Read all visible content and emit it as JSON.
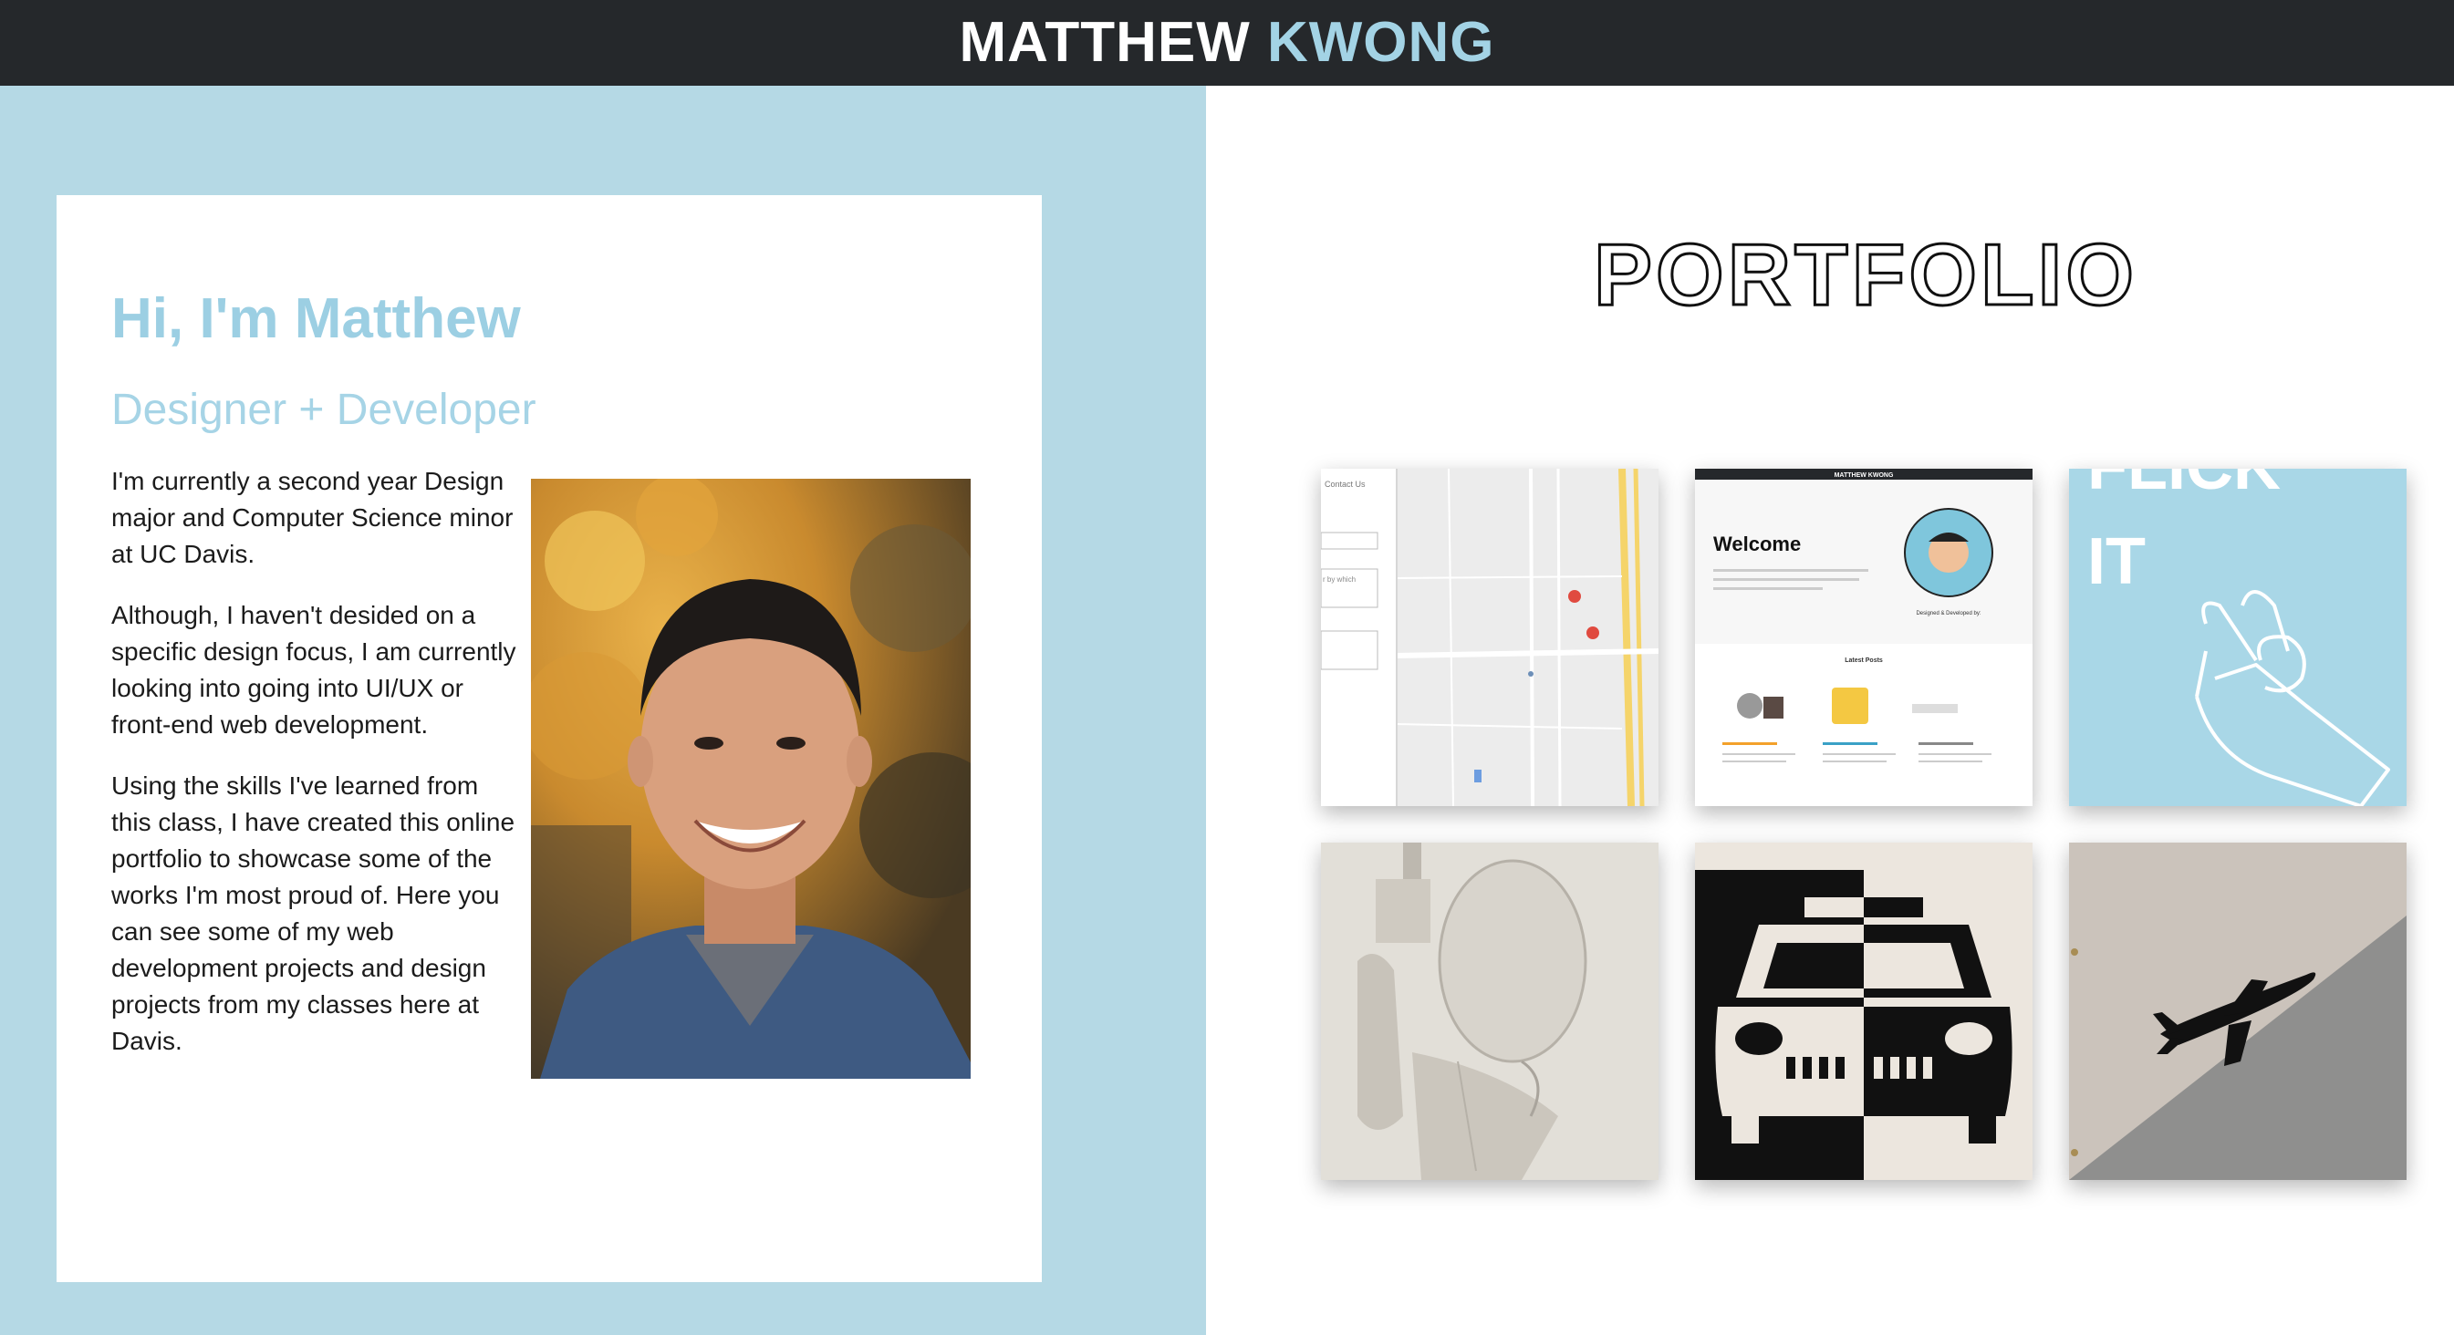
{
  "header": {
    "first_name": "MATTHEW",
    "last_name": "KWONG"
  },
  "intro": {
    "greeting": "Hi, I'm Matthew",
    "role": "Designer + Developer",
    "paragraphs": [
      "I'm currently a second year Design major and Computer Science minor at UC Davis.",
      "Although, I haven't desided on a specific design focus, I am currently looking into going into UI/UX or front-end web development.",
      "Using the skills I've learned from this class, I have created this online portfolio to showcase some of the works I'm most proud of. Here you can see some of my web development projects and design projects from my classes here at Davis."
    ]
  },
  "portfolio": {
    "title": "PORTFOLIO",
    "tiles": [
      {
        "name": "map-contact-project",
        "texts": {
          "contact": "Contact Us",
          "field_hint": "r by which"
        }
      },
      {
        "name": "blog-website-project",
        "texts": {
          "site_title": "MATTHEW KWONG",
          "welcome": "Welcome",
          "latest": "Latest Posts",
          "designed_by": "Designed & Developed by:"
        }
      },
      {
        "name": "flick-it-poster",
        "texts": {
          "line1": "FLICK",
          "line2": "IT"
        }
      },
      {
        "name": "pencil-drawing-artwork"
      },
      {
        "name": "taxi-graphic-artwork"
      },
      {
        "name": "airplane-silhouette-artwork"
      }
    ]
  },
  "colors": {
    "header_bg": "#25282b",
    "accent": "#a3d3e5",
    "left_bg": "#b5d9e5"
  }
}
